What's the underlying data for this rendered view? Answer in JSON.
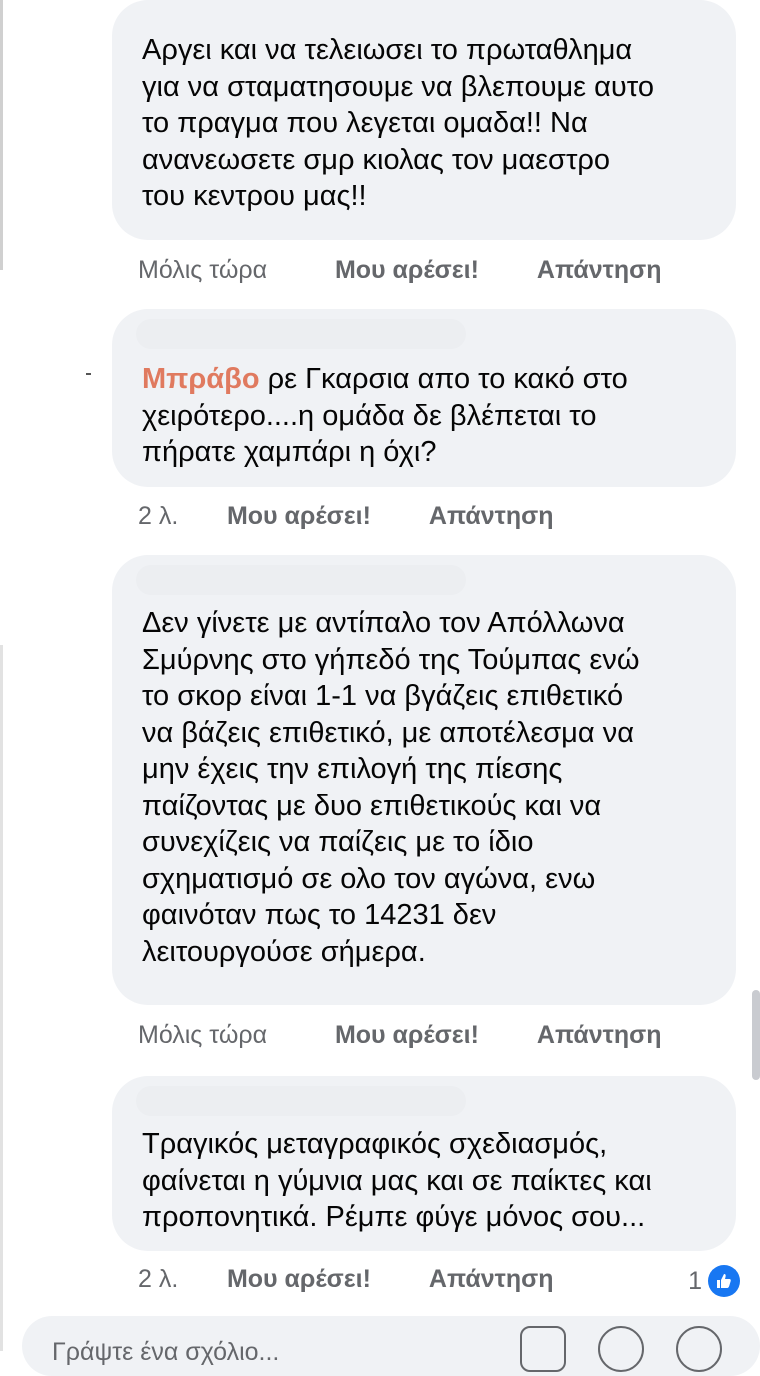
{
  "comments": [
    {
      "author": "",
      "text": "Αργει και να τελειωσει το πρωταθλημα\nγια να σταματησουμε να βλεπουμε αυτο\nτο πραγμα που λεγεται ομαδα!! Να\nανανεωσετε σμρ κιολας τον μαεστρο\nτου κεντρου μας!!",
      "time": "Μόλις τώρα",
      "like_label": "Μου αρέσει!",
      "reply_label": "Απάντηση"
    },
    {
      "author": "Μπράβο",
      "text": " ρε Γκαρσια απο το  κακό στο\nχειρότερο....η ομάδα δε βλέπεται το\nπήρατε χαμπάρι η όχι?",
      "time": "2 λ.",
      "like_label": "Μου αρέσει!",
      "reply_label": "Απάντηση"
    },
    {
      "author": "",
      "text": "Δεν γίνετε με αντίπαλο τον Απόλλωνα\nΣμύρνης στο γήπεδό της Τούμπας ενώ\nτο σκορ είναι 1-1 να βγάζεις επιθετικό\nνα βάζεις επιθετικό, με αποτέλεσμα να\nμην έχεις την επιλογή της πίεσης\nπαίζοντας με δυο επιθετικούς και να\nσυνεχίζεις να παίζεις με το ίδιο\nσχηματισμό σε ολο τον αγώνα, ενω\nφαινόταν πως το 14231 δεν\nλειτουργούσε σήμερα.",
      "time": "Μόλις τώρα",
      "like_label": "Μου αρέσει!",
      "reply_label": "Απάντηση"
    },
    {
      "author": "",
      "text": "Τραγικός μεταγραφικός σχεδιασμός,\nφαίνεται η γύμνια μας και σε παίκτες και\nπροπονητικά. Ρέμπε φύγε μόνος σου...",
      "time": "2 λ.",
      "like_label": "Μου αρέσει!",
      "reply_label": "Απάντηση",
      "reaction_count": "1",
      "reaction_icon": "like-thumb-icon"
    }
  ],
  "composer": {
    "placeholder": "Γράψτε ένα σχόλιο...",
    "icons": [
      "gif-icon",
      "sticker-icon",
      "emoji-icon"
    ]
  },
  "colors": {
    "bubble": "#f0f2f5",
    "author_highlight": "#e07a5f",
    "meta": "#65676b",
    "like_blue": "#1877f2"
  }
}
